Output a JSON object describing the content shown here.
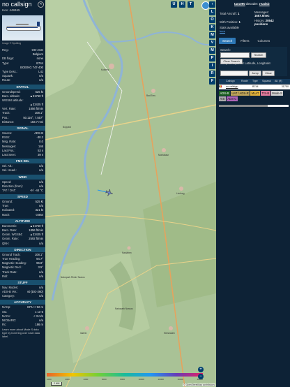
{
  "left_panel": {
    "callsign": "no callsign",
    "hex": "Hex: 448465",
    "photo_credit": "Image © Spotting",
    "close_icon": "close-icon",
    "info_rows": [
      {
        "label": "Reg.:",
        "value": "OO-ACE"
      },
      {
        "label": "",
        "value": "Belgium"
      },
      {
        "label": "DB flags:",
        "value": "none"
      },
      {
        "label": "Type:",
        "value": "B744"
      },
      {
        "label": "",
        "value": "BOEING 747-400"
      },
      {
        "label": "Type Desc.:",
        "value": "L4J"
      },
      {
        "label": "Squawk:",
        "value": "n/a"
      },
      {
        "label": "Route:",
        "value": "n/a"
      }
    ],
    "sections": [
      {
        "title": "SPATIAL",
        "rows": [
          {
            "label": "Groundspeed:",
            "value": "525 kt"
          },
          {
            "label": "Baro. altitude:",
            "value": "▲31750 ft"
          },
          {
            "label": "WGS84 altitude:",
            "value": ""
          },
          {
            "label": "",
            "value": "▲32425 ft"
          },
          {
            "label": "Vert. Rate:",
            "value": "1856 ft/min"
          },
          {
            "label": "Track:",
            "value": "108.1°"
          },
          {
            "label": "Pos.:",
            "value": "50.116°, 7.557°"
          },
          {
            "label": "Distance:",
            "value": "183.7 nmi"
          }
        ]
      },
      {
        "title": "SIGNAL",
        "rows": [
          {
            "label": "Source:",
            "value": "ADS-B"
          },
          {
            "label": "RSSI:",
            "value": "-30.2"
          },
          {
            "label": "Msg. Rate:",
            "value": "0.0"
          },
          {
            "label": "Messages:",
            "value": "146"
          },
          {
            "label": "Last Pos.:",
            "value": "53 s"
          },
          {
            "label": "Last Seen:",
            "value": "39 s"
          }
        ]
      },
      {
        "title": "FMS SEL",
        "rows": [
          {
            "label": "Sel. Alt.:",
            "value": "n/a"
          },
          {
            "label": "Sel. Head.:",
            "value": "n/a"
          }
        ]
      },
      {
        "title": "WIND",
        "rows": [
          {
            "label": "Speed:",
            "value": "n/a"
          },
          {
            "label": "Direction (from):",
            "value": "n/a"
          },
          {
            "label": "TAT / OAT:",
            "value": "-9 / -44 °C"
          }
        ]
      },
      {
        "title": "SPEED",
        "rows": [
          {
            "label": "Ground:",
            "value": "525 kt"
          },
          {
            "label": "True:",
            "value": "n/a"
          },
          {
            "label": "Indicated:",
            "value": "321 kt"
          },
          {
            "label": "Mach:",
            "value": "0.864"
          }
        ]
      },
      {
        "title": "ALTITUDE",
        "rows": [
          {
            "label": "Barometric:",
            "value": "▲31750 ft"
          },
          {
            "label": "Baro. Rate:",
            "value": "1856 ft/min"
          },
          {
            "label": "Geom. WGS84:",
            "value": "▲32425 ft"
          },
          {
            "label": "Geom. Rate:",
            "value": "2592 ft/min"
          },
          {
            "label": "QNH:",
            "value": "n/a"
          }
        ]
      },
      {
        "title": "DIRECTION",
        "rows": [
          {
            "label": "Ground Track:",
            "value": "108.1°"
          },
          {
            "label": "True Heading:",
            "value": "94.7°"
          },
          {
            "label": "Magnetic Heading:",
            "value": "96.8°"
          },
          {
            "label": "Magnetic Decl.:",
            "value": "3.5°"
          },
          {
            "label": "Track Rate:",
            "value": "n/a"
          },
          {
            "label": "Roll:",
            "value": "n/a"
          }
        ]
      },
      {
        "title": "STUFF",
        "rows": [
          {
            "label": "Nav. Modes:",
            "value": "n/a"
          },
          {
            "label": "ADS-B Ver.:",
            "value": "v0 (DO-260)"
          },
          {
            "label": "Category:",
            "value": "n/a"
          }
        ]
      },
      {
        "title": "ACCURACY",
        "rows": [
          {
            "label": "NACp:",
            "value": "EPU < 92 m"
          },
          {
            "label": "SIL:",
            "value": "≤ 1e-5"
          },
          {
            "label": "NACv:",
            "value": "< 3 m/s"
          },
          {
            "label": "NICBARO:",
            "value": "n/a"
          },
          {
            "label": "Rc:",
            "value": "186 m"
          }
        ]
      }
    ],
    "footer_note": "Learn more about Mode S data type by hovering over each data label."
  },
  "map": {
    "top_buttons": [
      "U",
      "H",
      "T"
    ],
    "side_buttons": [
      "‹",
      "L",
      "O",
      "K",
      "M",
      "V",
      "M",
      "P",
      "I",
      "R",
      "F"
    ],
    "zoom_in": "+",
    "zoom_out": "−",
    "scale_label": "2 NM",
    "alt_ticks": [
      "1000",
      "2000",
      "4000",
      "6000",
      "8000",
      "10000",
      "20000",
      "30000",
      "40000"
    ],
    "attribution": "© OpenStreetMap contributors",
    "towns": [
      "Koblenz",
      "Bad Ems",
      "Montabaur",
      "Limburg",
      "Nastätten",
      "Idstein",
      "Wiesbaden",
      "Naturpark Nassau",
      "Naturpark Rhein-Taunus",
      "Boppard"
    ]
  },
  "right_panel": {
    "version_prefix": "tar1090",
    "version_label": "decoder:",
    "version_link": "readsb",
    "total_aircraft_label": "Total Aircraft:",
    "total_aircraft_value": "1",
    "messages_label": "Messages:",
    "messages_value": "1657.5/sec",
    "with_position_label": "With Position:",
    "with_position_value": "1",
    "history_label": "History:",
    "history_value": "20542 positions",
    "stats_label": "Stats available",
    "stats_link": "here",
    "tabs": [
      "Search",
      "Filters",
      "Columns"
    ],
    "search_label": "Search:",
    "search_button": "Search",
    "clear_search_button": "Clear Search",
    "jump_label": "Jump to Airport or Latitude, Longitude:",
    "jump_button": "Jump",
    "clear_button": "Clear",
    "table_headers": [
      "",
      "Callsign",
      "Route",
      "Type",
      "Squawk",
      "Alt. (ft)"
    ],
    "table_row": {
      "flag": "🇧🇪",
      "callsign": "no callsign",
      "route": "",
      "type": "B744",
      "squawk": "",
      "alt": "31750"
    },
    "source_chips": [
      {
        "label": "ADS-B",
        "color": "#1b5e20"
      },
      {
        "label": "UAT / ADS-R",
        "color": "#c1a75b"
      },
      {
        "label": "MLAT",
        "color": "#e0b13b"
      },
      {
        "label": "TIS-B",
        "color": "#e47b9e"
      },
      {
        "label": "Mode-S",
        "color": "#d6d6d6"
      },
      {
        "label": "AIS",
        "color": "#aaaaaa"
      },
      {
        "label": "ADS-C",
        "color": "#ad65b6"
      }
    ]
  }
}
